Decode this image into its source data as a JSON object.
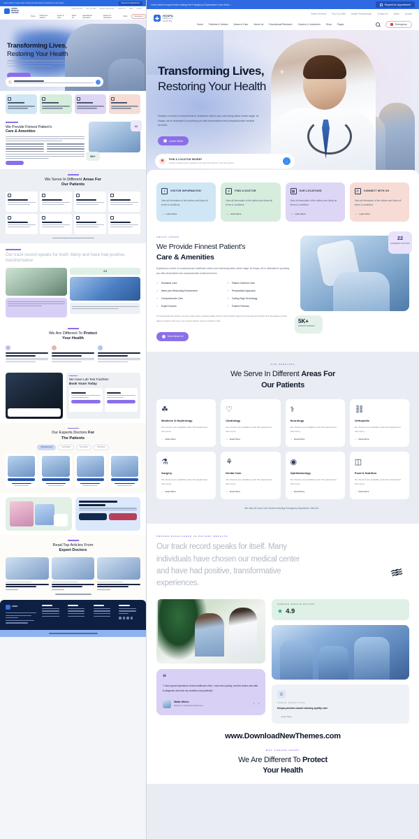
{
  "announcement": {
    "text": "Learn what to expect when visiting the Emergency Department Learn More  →",
    "cta": "Request An Appointment"
  },
  "brand": {
    "name": "HOSPA",
    "line2": "MEDICAL",
    "line3": "CENTRE"
  },
  "topnav": [
    "Online Services",
    "Pay Your Bills",
    "Health Professionals",
    "Contact Us",
    "News",
    "Donate"
  ],
  "mainnav": [
    "Home",
    "Patients & Visitors",
    "Areas of Care",
    "About Us",
    "Educational Research",
    "Careers & Volunteers",
    "Shop",
    "Pages"
  ],
  "emergency_label": "Emergency",
  "hero": {
    "title_line1": "Transforming Lives,",
    "title_line2": "Restoring Your Health",
    "lead": "Reclaim a world of comprehensive healthcare where your well-being takes center stage. At Hospa, we're dedicated to providing you with personalized and compassionate medical services.",
    "cta": "Learn More",
    "locator_title": "FIND A LOCATION NEARBY",
    "locator_sub": "Hospa medical center operates more than 20 locations. Find the nearest.",
    "locator_arrow": "→"
  },
  "feature_cards": [
    {
      "icon": "info-icon",
      "glyph": "i",
      "title": "VISITOR INFORMATION",
      "desc": "View all information of the visitors and follow all terms & conditions.",
      "link": "Learn More",
      "color": "#cfe6f5"
    },
    {
      "icon": "stethoscope-icon",
      "glyph": "♕",
      "title": "FIND A DOCTOR",
      "desc": "View all information of the visitors and follow all terms & conditions.",
      "link": "Learn More",
      "color": "#d6ecdd"
    },
    {
      "icon": "location-icon",
      "glyph": "▦",
      "title": "OUR LOCATIONS",
      "desc": "View all information of the visitors and follow all terms & conditions.",
      "link": "Learn More",
      "color": "#ddd6f4"
    },
    {
      "icon": "connect-icon",
      "glyph": "✆",
      "title": "CONNECT WITH US",
      "desc": "View all information of the visitors and follow all terms & conditions.",
      "link": "Learn More",
      "color": "#f6dcd5"
    }
  ],
  "about": {
    "kicker": "ABOUT HOSPA",
    "title_line1": "We Provide Finnest Patient's",
    "title_line2": "Care & Amenities",
    "para": "Experience a world of comprehensive healthcare where your well-being takes center stage. At Hospa, we're dedicated to providing you with personalized and compassionate medical services.",
    "checklist": [
      "Seamless Care",
      "Patient-Centered Care",
      "Warm and Welcoming Environment",
      "Personalized Approach",
      "Comprehensive Care",
      "Cutting Edge Technology",
      "Expert Doctors",
      "Positive Reviews"
    ],
    "para2": "Of substantial and stricter services quite beam medical award doctors clinic health support and accept all benefits visit all equipment web digest sections refer as to our service before meet in inclusion visit.",
    "cta": "More About Us",
    "stat1_value": "22",
    "stat1_label": "DIFFERENT DOCTORS",
    "stat2_value": "5K+",
    "stat2_label": "PATIENTS SERVING"
  },
  "services": {
    "kicker": "OUR SERVICES",
    "title_line1": "We Serve In Different ",
    "title_bold1": "Areas For",
    "title_bold2": "Our Patients",
    "items": [
      {
        "icon": "kidney-icon",
        "glyph": "☘",
        "name": "Medicine & Nephrology",
        "desc": "20+ Doctors are available under this department who serve.",
        "link": "Read More"
      },
      {
        "icon": "heart-pulse-icon",
        "glyph": "♡",
        "name": "Cardiology",
        "desc": "20+ Doctors are available under this department who serve.",
        "link": "Read More"
      },
      {
        "icon": "brain-icon",
        "glyph": "⚕",
        "name": "Neurology",
        "desc": "20+ Doctors are available under this department who serve.",
        "link": "Read More"
      },
      {
        "icon": "bone-icon",
        "glyph": "⛓",
        "name": "Orthopedic",
        "desc": "20+ Doctors are available under this department who serve.",
        "link": "Read More"
      },
      {
        "icon": "syringe-icon",
        "glyph": "⚗",
        "name": "Surgery",
        "desc": "20+ Doctors are available under this department who serve.",
        "link": "Read More"
      },
      {
        "icon": "tooth-icon",
        "glyph": "⚘",
        "name": "Dental Care",
        "desc": "20+ Doctors are available under this department who serve.",
        "link": "Read More"
      },
      {
        "icon": "eye-icon",
        "glyph": "◉",
        "name": "Ophthalmology",
        "desc": "20+ Doctors are available under this department who serve.",
        "link": "Read More"
      },
      {
        "icon": "nutrition-icon",
        "glyph": "◫",
        "name": "Food & Nutrition",
        "desc": "20+ Doctors are available under this department who serve.",
        "link": "Read More"
      }
    ],
    "footer_note": "We have 18 more Care Service including Emergency Department. View All  →"
  },
  "track": {
    "kicker": "PROVEN EXCELLENCE IN PATIENT RESULTS",
    "line1": "Our track record speaks for itself. Many",
    "line2_bold": "individuals have chosen ",
    "line2_muted": "our medical center",
    "line3_muted": "and have had positive, transformative",
    "line4_muted": "experiences."
  },
  "testimonial": {
    "quote_mark": "❝",
    "text": "\"I had a great experience at this healthcare clinic. I was seen quickly, and the doctor was able to diagnose and treat my condition very patiently.\"",
    "author": "Walter Whrrio",
    "role": "Resident in Cardiology Department",
    "prev": "‹",
    "next": "›"
  },
  "rating": {
    "label": "AVERAGE SERVICE RATINGS",
    "star": "★",
    "value": "4.9"
  },
  "award": {
    "icon": "trophy-icon",
    "glyph": "♕",
    "kicker": "USEFUL AWARD CARD",
    "title": "Hospa provides award winning quality care",
    "link": "Learn More"
  },
  "watermark": "www.DownloadNewThemes.com",
  "different": {
    "kicker": "WHY CHOOSE HOSPA",
    "title_plain": "We Are Different To ",
    "title_bold": "Protect",
    "title_line2": "Your Health"
  },
  "thumbnail": {
    "lab": {
      "kicker": "LAB TEST",
      "title1": "We Have Lab Test Facilities",
      "title2": "Book Yours Today"
    },
    "doctors": {
      "title1": "Our Experts Doctors ",
      "title_bold": "For",
      "title2": "The Patients",
      "tabs": [
        "All Departments",
        "Cardiologist",
        "Neurologist",
        "Orthopedic"
      ],
      "names": [
        "Dr. Jane Breet",
        "Dr. Peterson Jen",
        "Dr. Philip Harmo",
        "Dr. Clarke Betrus"
      ]
    },
    "different": {
      "cards": [
        "First And Best In Care, Best Service Experience",
        "Serving All People Through Exemplary Care",
        "Specialty Medicine With Compassionate Care"
      ]
    },
    "promo": {
      "title1": "Download Our",
      "title2": "Mobile App For The Best Experience"
    },
    "blog": {
      "kicker": "OUR ARTICLES",
      "title1": "Read Top Articles From",
      "title_bold": "Expert Doctors",
      "posts": [
        "Tech Talk: Exploring Cutting Edge Medical Technologies at Hospa",
        "Navigating Your Health Journey: A Comprehensive Guide",
        "Patient Stories: Empowering Transformations at Hospa"
      ]
    },
    "footer": {
      "cols": [
        "Company",
        "About",
        "Support",
        "Find & Legal"
      ]
    }
  }
}
